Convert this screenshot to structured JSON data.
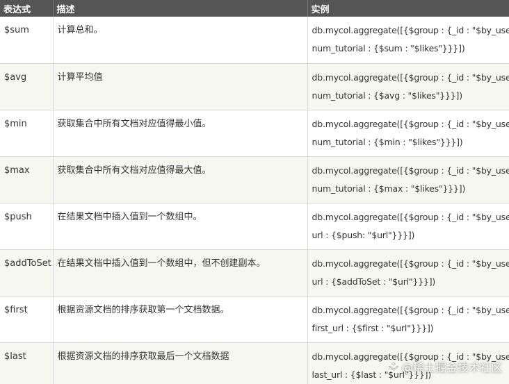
{
  "table": {
    "headers": [
      "表达式",
      "描述",
      "实例"
    ],
    "rows": [
      {
        "expr": "$sum",
        "desc": "计算总和。",
        "example_line1": "db.mycol.aggregate([{$group : {_id : \"$by_user\",",
        "example_line2": "num_tutorial : {$sum : \"$likes\"}}}])"
      },
      {
        "expr": "$avg",
        "desc": "计算平均值",
        "example_line1": "db.mycol.aggregate([{$group : {_id : \"$by_user\",",
        "example_line2": "num_tutorial : {$avg : \"$likes\"}}}])"
      },
      {
        "expr": "$min",
        "desc": "获取集合中所有文档对应值得最小值。",
        "example_line1": "db.mycol.aggregate([{$group : {_id : \"$by_user\",",
        "example_line2": "num_tutorial : {$min : \"$likes\"}}}])"
      },
      {
        "expr": "$max",
        "desc": "获取集合中所有文档对应值得最大值。",
        "example_line1": "db.mycol.aggregate([{$group : {_id : \"$by_user\",",
        "example_line2": "num_tutorial : {$max : \"$likes\"}}}])"
      },
      {
        "expr": "$push",
        "desc": "在结果文档中插入值到一个数组中。",
        "example_line1": "db.mycol.aggregate([{$group : {_id : \"$by_user\",",
        "example_line2": "url : {$push: \"$url\"}}}])"
      },
      {
        "expr": "$addToSet",
        "desc": "在结果文档中插入值到一个数组中，但不创建副本。",
        "example_line1": "db.mycol.aggregate([{$group : {_id : \"$by_user\",",
        "example_line2": "url : {$addToSet : \"$url\"}}}])"
      },
      {
        "expr": "$first",
        "desc": "根据资源文档的排序获取第一个文档数据。",
        "example_line1": "db.mycol.aggregate([{$group : {_id : \"$by_user\",",
        "example_line2": "first_url : {$first : \"$url\"}}}])"
      },
      {
        "expr": "$last",
        "desc": "根据资源文档的排序获取最后一个文档数据",
        "example_line1": "db.mycol.aggregate([{$group : {_id : \"$by_user\",",
        "example_line2": "last_url : {$last : \"$url\"}}}])"
      }
    ]
  },
  "watermark": {
    "text": "@稀土掘金技术社区",
    "icon": "juejin-logo-icon"
  },
  "colors": {
    "header_bg": "#555555",
    "header_text": "#ffffff",
    "stripe_bg": "#f7f7f2",
    "border": "#d8d8d8",
    "text": "#333333"
  }
}
